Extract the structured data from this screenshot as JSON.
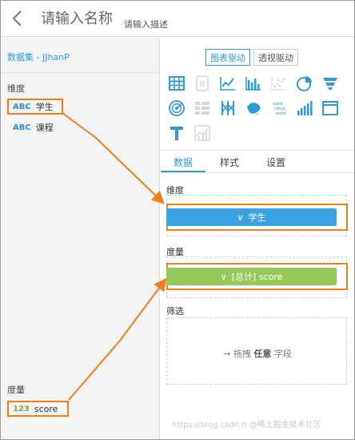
{
  "header": {
    "title_placeholder": "请输入名称",
    "desc_placeholder": "请输入描述"
  },
  "left": {
    "dataset_link": "数据集 - JJhanP",
    "dimension_label": "维度",
    "dimension_fields": [
      {
        "type": "ABC",
        "name": "学生"
      },
      {
        "type": "ABC",
        "name": "课程"
      }
    ],
    "measure_label": "度量",
    "measure_fields": [
      {
        "type": "123",
        "name": "score"
      }
    ]
  },
  "right": {
    "drive_modes": [
      "图表驱动",
      "透视驱动"
    ],
    "chart_icons": [
      "table-icon",
      "number-card-icon",
      "line-chart-icon",
      "bar-chart-icon",
      "scatter-icon",
      "pie-chart-icon",
      "funnel-icon",
      "radar-icon",
      "stacked-bar-icon",
      "parallel-axis-icon",
      "china-map-icon",
      "word-cloud-icon",
      "bar-rank-icon",
      "rich-text-frame-icon",
      "text-icon",
      "waterfall-icon"
    ],
    "word_cloud_text": [
      "word",
      "cloud",
      "word"
    ],
    "tabs": [
      "数据",
      "样式",
      "设置"
    ],
    "dimension_zone": {
      "label": "维度",
      "pill": "学生",
      "pill_icon": "∨"
    },
    "measure_zone": {
      "label": "度量",
      "pill": "[总计] score",
      "pill_icon": "∨"
    },
    "filter_zone": {
      "label": "筛选",
      "arrow": "→",
      "text_before": "拖拽",
      "text_bold": "任意",
      "text_after": "字段"
    }
  },
  "watermark": "https://blog.csdn.n",
  "watermark2": "@稀土掘金技术社区",
  "colors": {
    "accent_blue": "#2e9bd6",
    "pill_blue": "#3aa3e3",
    "pill_green": "#95c95a",
    "highlight": "#f07e1b"
  }
}
